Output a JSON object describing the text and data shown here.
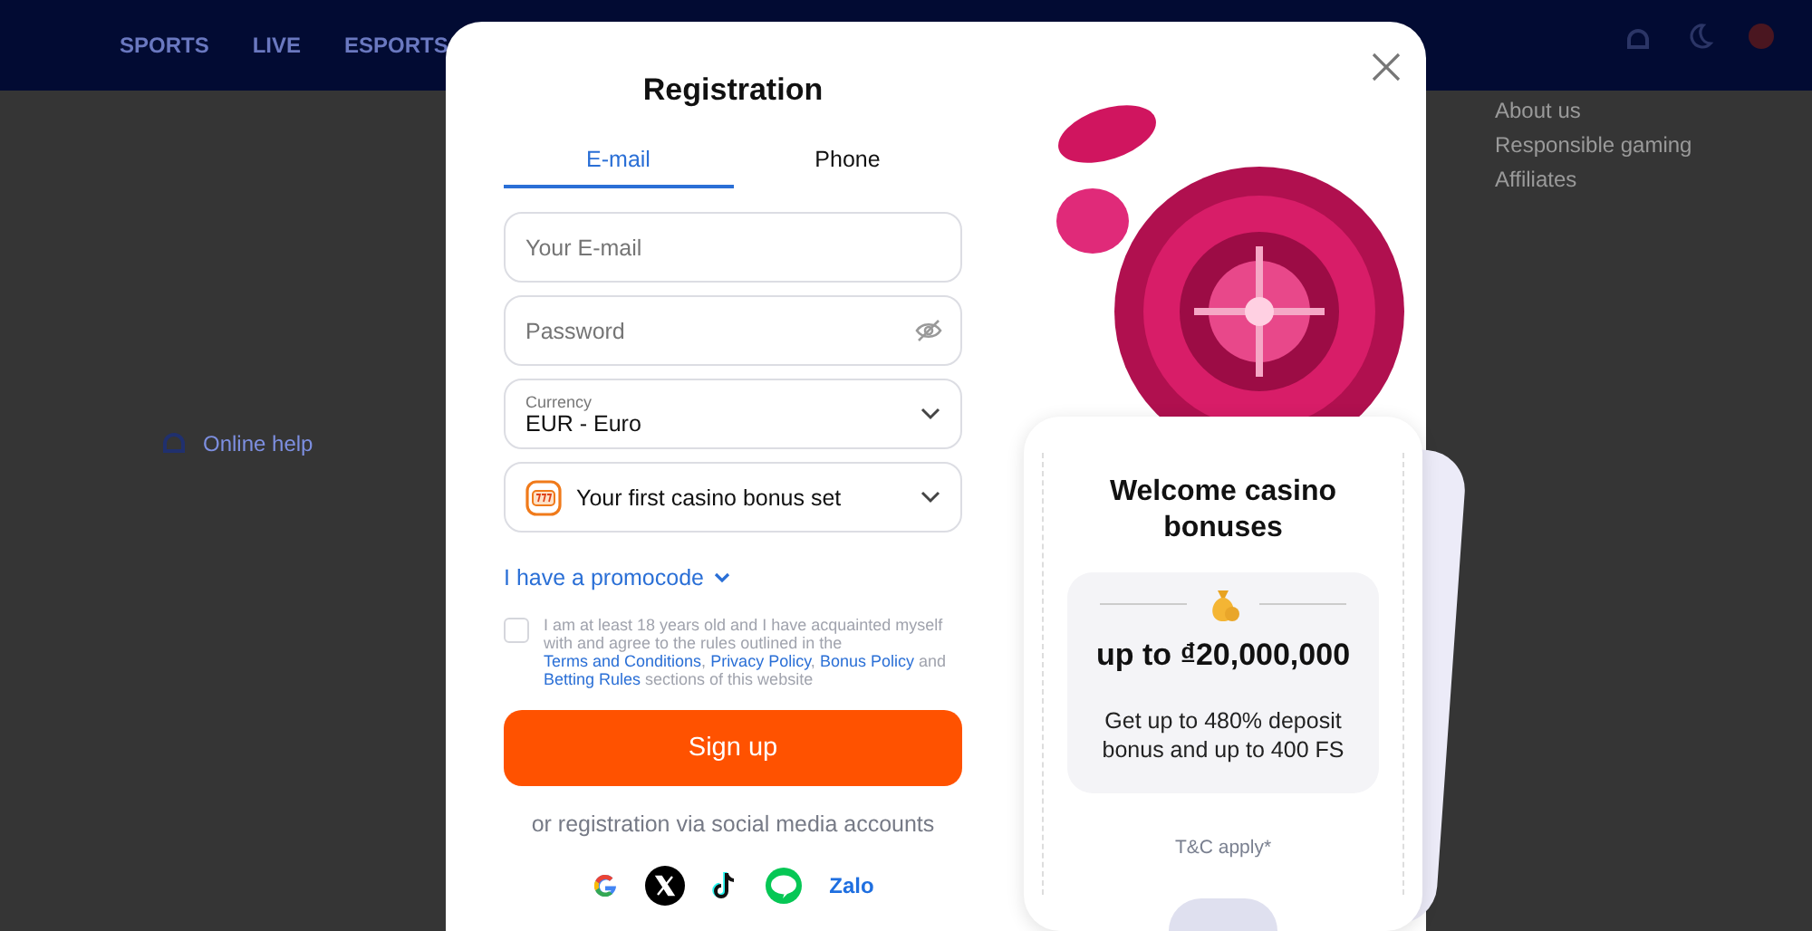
{
  "header": {
    "nav": [
      {
        "label": "SPORTS"
      },
      {
        "label": "LIVE"
      },
      {
        "label": "ESPORTS"
      }
    ]
  },
  "footer": {
    "links": [
      "About us",
      "Responsible gaming",
      "Affiliates"
    ],
    "help": "Online help"
  },
  "modal": {
    "title": "Registration",
    "tabs": [
      {
        "label": "E-mail",
        "selected": true
      },
      {
        "label": "Phone",
        "selected": false
      }
    ],
    "fields": [
      {
        "kind": "text",
        "placeholder": "Your E-mail"
      },
      {
        "kind": "password",
        "placeholder": "Password"
      },
      {
        "kind": "select",
        "label": "Currency",
        "value": "EUR - Euro"
      },
      {
        "kind": "bonus",
        "value": "Your first casino bonus set"
      }
    ],
    "promocode": "I have a promocode",
    "agreement": {
      "checked": false,
      "parts": [
        {
          "text": "I am at least 18 years old and I have acquainted myself with and agree to the rules outlined in the ",
          "kind": "text"
        },
        {
          "text": "Terms and Conditions",
          "kind": "link"
        },
        {
          "text": ", ",
          "kind": "text"
        },
        {
          "text": "Privacy Policy",
          "kind": "link"
        },
        {
          "text": ", ",
          "kind": "text"
        },
        {
          "text": "Bonus Policy",
          "kind": "link"
        },
        {
          "text": " and ",
          "kind": "text"
        },
        {
          "text": "Betting Rules",
          "kind": "link"
        },
        {
          "text": " sections of this website",
          "kind": "text"
        }
      ]
    },
    "submit": "Sign up",
    "social_caption": "or registration via social media accounts",
    "social": [
      {
        "kind": "google"
      },
      {
        "kind": "x"
      },
      {
        "kind": "tiktok"
      },
      {
        "kind": "line"
      },
      {
        "kind": "zalo",
        "label": "Zalo"
      }
    ]
  },
  "promo": {
    "title": "Welcome casino bonuses",
    "amount": "up to ₫20,000,000",
    "description": "Get up to 480% deposit bonus and up to 400 FS",
    "terms": "T&C apply*"
  }
}
